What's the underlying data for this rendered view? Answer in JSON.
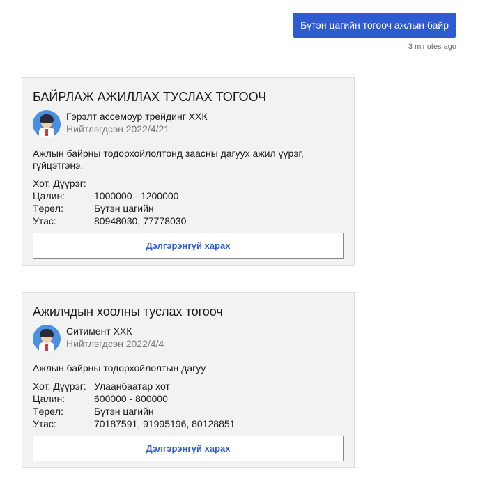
{
  "message": {
    "text": "Бүтэн цагийн тогооч ажлын байр",
    "time": "3 minutes ago"
  },
  "jobs": [
    {
      "title": "БАЙРЛАЖ АЖИЛЛАХ ТУСЛАХ ТОГООЧ",
      "company": "Гэрэлт ассемоур трейдинг ХХК",
      "posted": "Нийтлэгдсэн 2022/4/21",
      "description": "Ажлын байрны тодорхойлолтонд заасны дагуух ажил үүрэг, гүйцэтгэнэ.",
      "fields": [
        {
          "label": "Хот, Дүүрэг:",
          "value": ""
        },
        {
          "label": "Цалин:",
          "value": "1000000 - 1200000"
        },
        {
          "label": "Төрөл:",
          "value": "Бүтэн цагийн"
        },
        {
          "label": "Утас:",
          "value": "80948030, 77778030"
        }
      ],
      "button": "Дэлгэрэнгүй харах"
    },
    {
      "title": "Ажилчдын хоолны туслах тогооч",
      "company": "Ситимент ХХК",
      "posted": "Нийтлэгдсэн 2022/4/4",
      "description": "Ажлын байрны тодорхойлолтын дагуу",
      "fields": [
        {
          "label": "Хот, Дүүрэг:",
          "value": "Улаанбаатар хот"
        },
        {
          "label": "Цалин:",
          "value": "600000 - 800000"
        },
        {
          "label": "Төрөл:",
          "value": "Бүтэн цагийн"
        },
        {
          "label": "Утас:",
          "value": "70187591, 91995196, 80128851"
        }
      ],
      "button": "Дэлгэрэнгүй харах"
    }
  ]
}
